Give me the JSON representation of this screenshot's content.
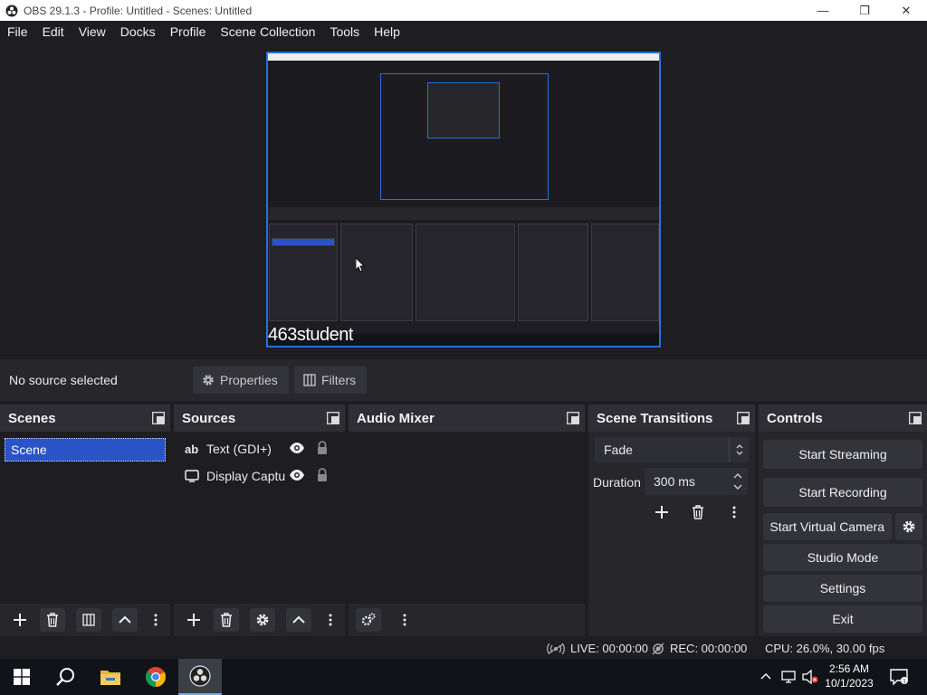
{
  "window": {
    "title": "OBS 29.1.3 - Profile: Untitled - Scenes: Untitled",
    "minimize_glyph": "—",
    "maximize_glyph": "❐",
    "close_glyph": "✕"
  },
  "menu": [
    "File",
    "Edit",
    "View",
    "Docks",
    "Profile",
    "Scene Collection",
    "Tools",
    "Help"
  ],
  "preview": {
    "overlay_text": "463student"
  },
  "source_toolbar": {
    "status": "No source selected",
    "properties_label": "Properties",
    "filters_label": "Filters"
  },
  "docks": {
    "scenes": {
      "title": "Scenes",
      "items": [
        "Scene"
      ]
    },
    "sources": {
      "title": "Sources",
      "items": [
        {
          "label": "Text (GDI+)",
          "icon": "text-icon"
        },
        {
          "label": "Display Captur",
          "icon": "monitor-icon"
        }
      ]
    },
    "mixer": {
      "title": "Audio Mixer"
    },
    "transitions": {
      "title": "Scene Transitions",
      "selected": "Fade",
      "duration_label": "Duration",
      "duration_value": "300 ms"
    },
    "controls": {
      "title": "Controls",
      "start_streaming": "Start Streaming",
      "start_recording": "Start Recording",
      "start_virtual_camera": "Start Virtual Camera",
      "studio_mode": "Studio Mode",
      "settings": "Settings",
      "exit": "Exit"
    }
  },
  "status": {
    "live": "LIVE: 00:00:00",
    "rec": "REC: 00:00:00",
    "cpu": "CPU: 26.0%, 30.00 fps"
  },
  "taskbar": {
    "time": "2:56 AM",
    "date": "10/1/2023",
    "apps": [
      "start-icon",
      "search-icon",
      "file-explorer-icon",
      "chrome-icon",
      "obs-icon"
    ]
  },
  "colors": {
    "accent": "#2a53c5",
    "preview_border": "#2b6fd6",
    "dock_bg": "#26262b",
    "window_bg": "#1e1e22"
  }
}
